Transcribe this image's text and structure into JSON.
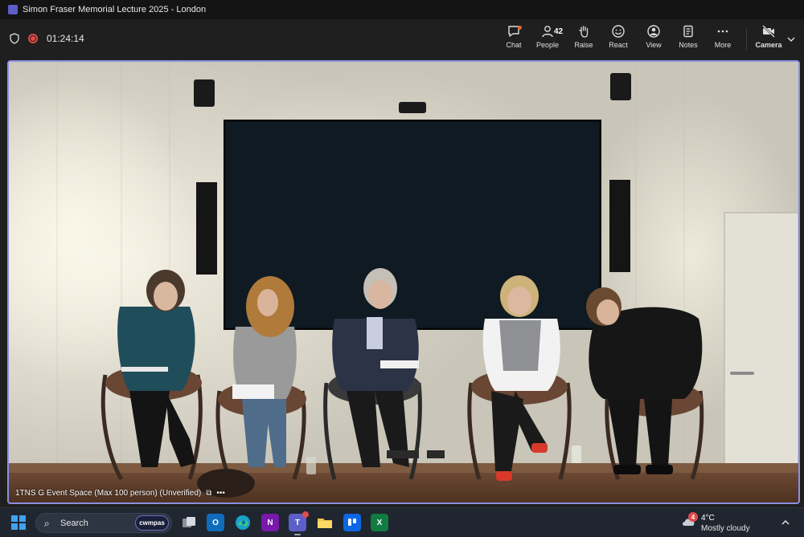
{
  "window": {
    "title": "Simon Fraser Memorial Lecture 2025 - London"
  },
  "meeting": {
    "elapsed": "01:24:14",
    "tools": [
      {
        "label": "Chat"
      },
      {
        "label": "People",
        "count": "42"
      },
      {
        "label": "Raise"
      },
      {
        "label": "React"
      },
      {
        "label": "View"
      },
      {
        "label": "Notes"
      },
      {
        "label": "More"
      },
      {
        "label": "Camera"
      }
    ]
  },
  "stage": {
    "caption": "1TNS G Event Space (Max 100 person) (Unverified)"
  },
  "taskbar": {
    "search_label": "Search",
    "search_chip": "cwmpas",
    "apps": [
      {
        "name": "Task View",
        "letter": ""
      },
      {
        "name": "Outlook",
        "letter": "O"
      },
      {
        "name": "Edge",
        "letter": ""
      },
      {
        "name": "OneNote",
        "letter": "N"
      },
      {
        "name": "Teams",
        "letter": "T"
      },
      {
        "name": "File Explorer",
        "letter": ""
      },
      {
        "name": "Trello",
        "letter": ""
      },
      {
        "name": "Excel",
        "letter": "X"
      }
    ],
    "weather": {
      "badge": "4",
      "temp": "4°C",
      "condition": "Mostly cloudy"
    }
  },
  "colors": {
    "accent": "#8b8fe0",
    "record": "#e04a4a",
    "teams": "#5b5fc7"
  }
}
